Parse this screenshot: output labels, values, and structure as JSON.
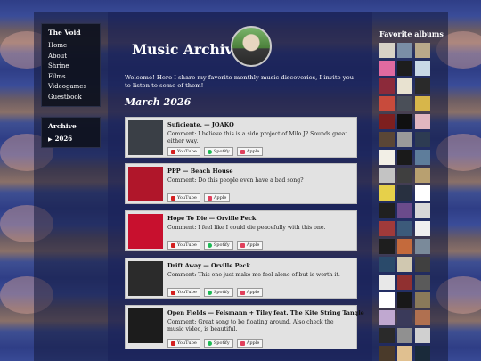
{
  "sidebar": {
    "heading": "The Void",
    "items": [
      "Home",
      "About",
      "Shrine",
      "Films",
      "Videogames",
      "Guestbook"
    ],
    "archive_heading": "Archive",
    "archive_year": "2026"
  },
  "header": {
    "title": "Music Archive",
    "intro": "Welcome! Here I share my favorite monthly music discoveries, I invite you to listen to some of them!"
  },
  "month_label": "March 2026",
  "buttons": {
    "youtube": "YouTube",
    "spotify": "Spotify",
    "apple": "Apple"
  },
  "entries": [
    {
      "title": "Suficiente. — JOAKO",
      "comment": "Comment: I believe this is a side project of Milo J? Sounds great either way.",
      "color": "#3a3f46",
      "spotify": true
    },
    {
      "title": "PPP — Beach House",
      "comment": "Comment: Do this people even have a bad song?",
      "color": "#b0162a",
      "spotify": false
    },
    {
      "title": "Hope To Die — Orville Peck",
      "comment": "Comment: I feel like I could die peacefully with this one.",
      "color": "#c8102e",
      "spotify": true
    },
    {
      "title": "Drift Away — Orville Peck",
      "comment": "Comment: This one just make me feel alone of but is worth it.",
      "color": "#2b2b2b",
      "spotify": true
    },
    {
      "title": "Open Fields — Felsmann + Tiley feat. The Kite String Tangle",
      "comment": "Comment: Great song to be floating around. Also check the music video, is beautiful.",
      "color": "#1c1c1c",
      "spotify": true
    }
  ],
  "right": {
    "title": "Favorite albums",
    "albums": [
      "#d7d2c6",
      "#7a8ea6",
      "#b9a98a",
      "#e06aa0",
      "#1d1d1d",
      "#c8d8e6",
      "#8c2a3a",
      "#e8e2d0",
      "#2a2a2a",
      "#c84b3c",
      "#4a4f58",
      "#d7b64a",
      "#7d1f1f",
      "#101010",
      "#e0b6c0",
      "#5a4636",
      "#9a9a9a",
      "#2d3b52",
      "#f2efe6",
      "#1a1a1a",
      "#5e7d9b",
      "#c3c3c3",
      "#3f3f3f",
      "#b8a070",
      "#e6d04a",
      "#283040",
      "#ffffff",
      "#202020",
      "#6b4b8b",
      "#d8d8d8",
      "#a03a3a",
      "#3c5a7a",
      "#efefef",
      "#1e1e1e",
      "#c46a3c",
      "#7a8a9a",
      "#2a4a6a",
      "#d0c8b0",
      "#404040",
      "#e8e8e8",
      "#903030",
      "#5a5a5a",
      "#ffffff",
      "#181818",
      "#8a7a5a",
      "#c0a8d0",
      "#3a3a5a",
      "#b07050",
      "#2a2a2a",
      "#909090",
      "#d0d0d0",
      "#4a3a2a",
      "#e0c090",
      "#1a2a3a"
    ]
  }
}
